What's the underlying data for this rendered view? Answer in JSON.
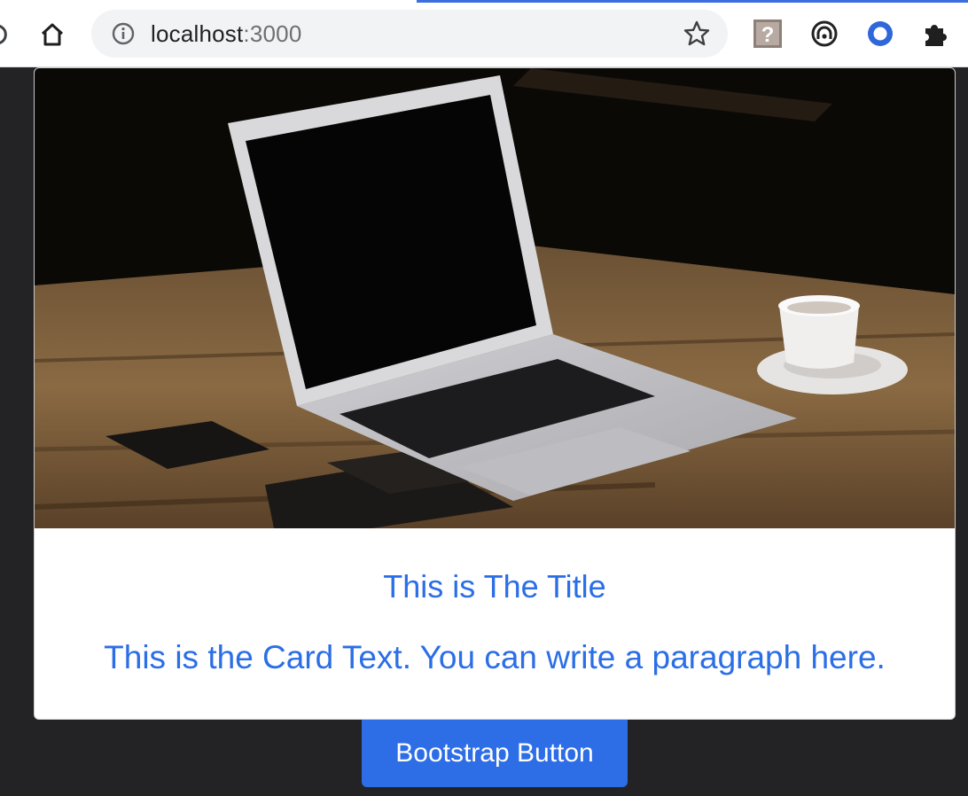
{
  "browser": {
    "url_host": "localhost",
    "url_port": ":3000",
    "icons": {
      "reload": "reload-icon",
      "home": "home-icon",
      "site_info": "info-icon",
      "bookmark": "star-icon",
      "extension_1": "help-extension-icon",
      "extension_2": "reader-extension-icon",
      "extension_3": "opera-extension-icon",
      "extensions": "puzzle-icon"
    },
    "accent_color": "#3b6fe0"
  },
  "card": {
    "image_subject": "laptop-on-wooden-table-photo",
    "title": "This is The Title",
    "text": "This is the Card Text. You can write a paragraph here.",
    "text_color": "#2b6ee6"
  },
  "button": {
    "label": "Bootstrap Button",
    "color": "#2d6de6"
  },
  "page": {
    "background": "#232325"
  }
}
